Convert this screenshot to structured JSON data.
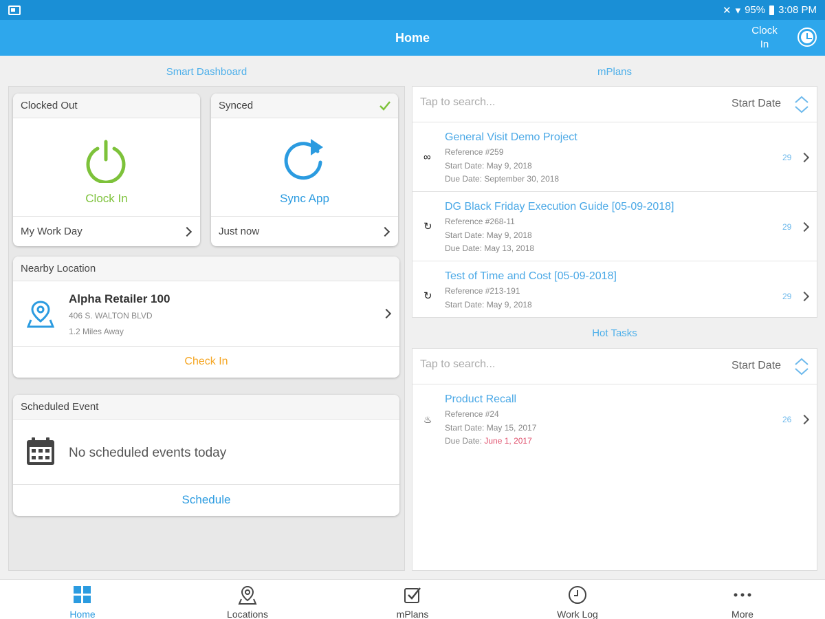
{
  "status_bar": {
    "battery": "95%",
    "time": "3:08 PM"
  },
  "app_bar": {
    "title": "Home",
    "clock_in_line1": "Clock",
    "clock_in_line2": "In"
  },
  "dashboard": {
    "section_title": "Smart Dashboard",
    "clock_card": {
      "header": "Clocked Out",
      "label": "Clock In",
      "footer": "My Work Day",
      "accent": "#7dc23a"
    },
    "sync_card": {
      "header": "Synced",
      "label": "Sync App",
      "footer": "Just now",
      "accent": "#2b9be0"
    },
    "nearby": {
      "header": "Nearby Location",
      "name": "Alpha Retailer 100",
      "address": "406 S. WALTON BLVD",
      "distance": "1.2 Miles Away",
      "action": "Check In"
    },
    "scheduled": {
      "header": "Scheduled Event",
      "empty_text": "No scheduled events today",
      "action": "Schedule"
    }
  },
  "mplans": {
    "section_title": "mPlans",
    "search_placeholder": "Tap to search...",
    "sort_label": "Start Date",
    "items": [
      {
        "icon": "infinity-icon",
        "title": "General Visit Demo Project",
        "reference": "Reference #259",
        "start": "Start Date: May 9, 2018",
        "due": "Due Date: September 30, 2018",
        "count": "29"
      },
      {
        "icon": "repeat-icon",
        "title": "DG Black Friday Execution Guide [05-09-2018]",
        "reference": "Reference #268-11",
        "start": "Start Date: May 9, 2018",
        "due": "Due Date: May 13, 2018",
        "count": "29"
      },
      {
        "icon": "repeat-icon",
        "title": "Test of Time and Cost [05-09-2018]",
        "reference": "Reference #213-191",
        "start": "Start Date: May 9, 2018",
        "due": "",
        "count": "29"
      }
    ]
  },
  "hot_tasks": {
    "section_title": "Hot Tasks",
    "search_placeholder": "Tap to search...",
    "sort_label": "Start Date",
    "items": [
      {
        "icon": "flame-icon",
        "title": "Product Recall",
        "reference": "Reference #24",
        "start": "Start Date: May 15, 2017",
        "due_prefix": "Due Date: ",
        "due_value": "June 1, 2017",
        "count": "26"
      }
    ]
  },
  "bottom_nav": {
    "items": [
      {
        "label": "Home",
        "active": true
      },
      {
        "label": "Locations",
        "active": false
      },
      {
        "label": "mPlans",
        "active": false
      },
      {
        "label": "Work Log",
        "active": false
      },
      {
        "label": "More",
        "active": false
      }
    ]
  }
}
